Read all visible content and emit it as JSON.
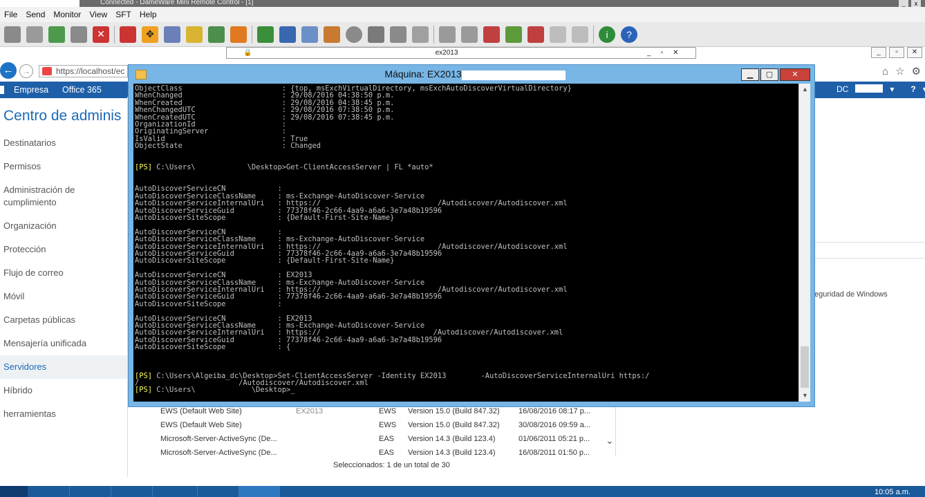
{
  "dameware": {
    "title": "Connected - DameWare Mini Remote Control - [1]",
    "menu": [
      "File",
      "Send",
      "Monitor",
      "View",
      "SFT",
      "Help"
    ],
    "remote_tab_title": "ex2013"
  },
  "browser": {
    "url": "https://localhost/ec",
    "o365": {
      "enterprise": "Empresa",
      "office365": "Office 365",
      "user": "DC",
      "help": "?"
    }
  },
  "eac": {
    "title": "Centro de adminis",
    "nav": [
      "Destinatarios",
      "Permisos",
      "Administración de cumplimiento",
      "Organización",
      "Protección",
      "Flujo de correo",
      "Móvil",
      "Carpetas públicas",
      "Mensajería unificada",
      "Servidores",
      "Híbrido",
      "herramientas"
    ],
    "active": "Servidores",
    "servers": [
      {
        "name": "EWS (Default Web Site)",
        "server": "EX2013",
        "type": "EWS",
        "version": "Version 15.0 (Build 847.32)",
        "date": "16/08/2016 08:17 p..."
      },
      {
        "name": "EWS (Default Web Site)",
        "server": "",
        "type": "EWS",
        "version": "Version 15.0 (Build 847.32)",
        "date": "30/08/2016 09:59 a..."
      },
      {
        "name": "Microsoft-Server-ActiveSync (De...",
        "server": "",
        "type": "EAS",
        "version": "Version 14.3 (Build 123.4)",
        "date": "01/06/2011 05:21 p..."
      },
      {
        "name": "Microsoft-Server-ActiveSync (De...",
        "server": "",
        "type": "EAS",
        "version": "Version 14.3 (Build 123.4)",
        "date": "16/08/2011 01:50 p..."
      }
    ],
    "status": "Seleccionados: 1 de un total de 30",
    "right_text": "eguridad de Windows"
  },
  "powershell": {
    "title": "Máquina: EX2013",
    "lines": [
      "ObjectClass                       : {top, msExchVirtualDirectory, msExchAutoDiscoverVirtualDirectory}",
      "WhenChanged                       : 29/08/2016 04:38:50 p.m.",
      "WhenCreated                       : 29/08/2016 04:38:45 p.m.",
      "WhenChangedUTC                    : 29/08/2016 07:38:50 p.m.",
      "WhenCreatedUTC                    : 29/08/2016 07:38:45 p.m.",
      "OrganizationId                    :",
      "OriginatingServer                 :",
      "IsValid                           : True",
      "ObjectState                       : Changed",
      "",
      "",
      "[PS] C:\\Users\\            \\Desktop>Get-ClientAccessServer | FL *auto*",
      "",
      "",
      "AutoDiscoverServiceCN            :",
      "AutoDiscoverServiceClassName     : ms-Exchange-AutoDiscover-Service",
      "AutoDiscoverServiceInternalUri   : https://                           /Autodiscover/Autodiscover.xml",
      "AutoDiscoverServiceGuid          : 77378f46-2c66-4aa9-a6a6-3e7a48b19596",
      "AutoDiscoverSiteScope            : {Default-First-Site-Name}",
      "",
      "AutoDiscoverServiceCN            :",
      "AutoDiscoverServiceClassName     : ms-Exchange-AutoDiscover-Service",
      "AutoDiscoverServiceInternalUri   : https://                           /Autodiscover/Autodiscover.xml",
      "AutoDiscoverServiceGuid          : 77378f46-2c66-4aa9-a6a6-3e7a48b19596",
      "AutoDiscoverSiteScope            : {Default-First-Site-Name}",
      "",
      "AutoDiscoverServiceCN            : EX2013",
      "AutoDiscoverServiceClassName     : ms-Exchange-AutoDiscover-Service",
      "AutoDiscoverServiceInternalUri   : https://                           /Autodiscover/Autodiscover.xml",
      "AutoDiscoverServiceGuid          : 77378f46-2c66-4aa9-a6a6-3e7a48b19596",
      "AutoDiscoverSiteScope            :",
      "",
      "AutoDiscoverServiceCN            : EX2013",
      "AutoDiscoverServiceClassName     : ms-Exchange-AutoDiscover-Service",
      "AutoDiscoverServiceInternalUri   : https://                          /Autodiscover/Autodiscover.xml",
      "AutoDiscoverServiceGuid          : 77378f46-2c66-4aa9-a6a6-3e7a48b19596",
      "AutoDiscoverSiteScope            : {",
      "",
      "",
      "",
      "[PS] C:\\Users\\Algeiba_dc\\Desktop>Set-ClientAccessServer -Identity EX2013        -AutoDiscoverServiceInternalUri https:/",
      "/                       /Autodiscover/Autodiscover.xml",
      "[PS] C:\\Users\\             \\Desktop>_"
    ]
  },
  "taskbar": {
    "clock": "10:05 a.m."
  }
}
